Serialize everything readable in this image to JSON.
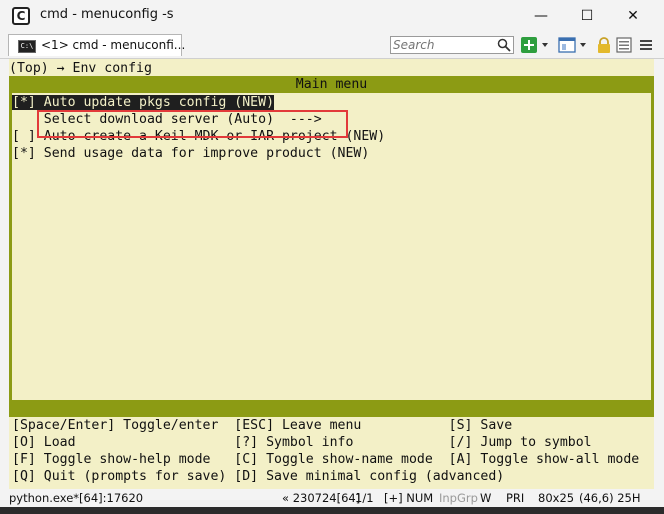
{
  "window": {
    "title": "cmd - menuconfig  -s",
    "app_icon_glyph": "C",
    "minimize_glyph": "—",
    "maximize_glyph": "☐",
    "close_glyph": "✕"
  },
  "toolbar": {
    "tab_label": "<1> cmd - menuconfi...",
    "tab_icon_text": "C:\\",
    "search_placeholder": "Search"
  },
  "terminal": {
    "breadcrumb": "(Top) → Env config",
    "menu_title": "Main menu",
    "items": [
      "[*] Auto update pkgs config (NEW)",
      "    Select download server (Auto)  --->",
      "[ ] Auto create a Keil MDK or IAR project (NEW)",
      "[*] Send usage data for improve product (NEW)"
    ],
    "help_lines": [
      "[Space/Enter] Toggle/enter  [ESC] Leave menu           [S] Save",
      "[O] Load                    [?] Symbol info            [/] Jump to symbol",
      "[F] Toggle show-help mode   [C] Toggle show-name mode  [A] Toggle show-all mode",
      "[Q] Quit (prompts for save) [D] Save minimal config (advanced)"
    ]
  },
  "status": {
    "process": "python.exe*[64]:17620",
    "build": "« 230724[64]",
    "page": "1/1",
    "caps": "[+] NUM",
    "inpgrp": "InpGrp",
    "w": "W",
    "pri": "PRI",
    "size": "80x25",
    "pos": "(46,6) 25H"
  },
  "colors": {
    "terminal_bg": "#f3f0c7",
    "accent_green": "#8c9b14",
    "highlight_red": "#e23a3a"
  }
}
